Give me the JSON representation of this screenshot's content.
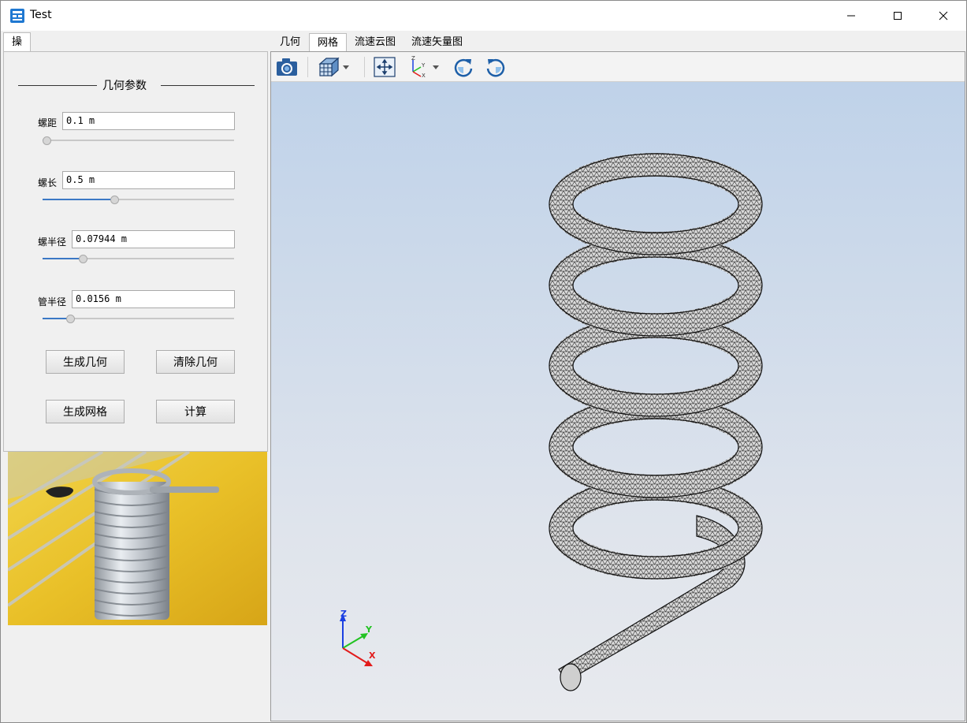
{
  "window": {
    "title": "Test"
  },
  "left_tabs": [
    {
      "label": "操作"
    }
  ],
  "params": {
    "group_title": "几何参数",
    "pitch": {
      "label": "螺距",
      "value": "0.1 m",
      "level": 0.0
    },
    "length": {
      "label": "螺长",
      "value": "0.5 m",
      "level": 0.37
    },
    "coil_radius": {
      "label": "螺半径",
      "value": "0.07944 m",
      "level": 0.2
    },
    "tube_radius": {
      "label": "管半径",
      "value": "0.0156 m",
      "level": 0.13
    }
  },
  "buttons": {
    "generate_geometry": "生成几何",
    "clear_geometry": "清除几何",
    "generate_mesh": "生成网格",
    "compute": "计算"
  },
  "right_tabs": [
    {
      "label": "几何"
    },
    {
      "label": "网格"
    },
    {
      "label": "流速云图"
    },
    {
      "label": "流速矢量图"
    }
  ],
  "axes": {
    "x": "X",
    "y": "Y",
    "z": "Z"
  },
  "colors": {
    "axis_x": "#e21b1b",
    "axis_y": "#22c322",
    "axis_z": "#1b3fe2",
    "slider_fill": "#3b78c5"
  }
}
